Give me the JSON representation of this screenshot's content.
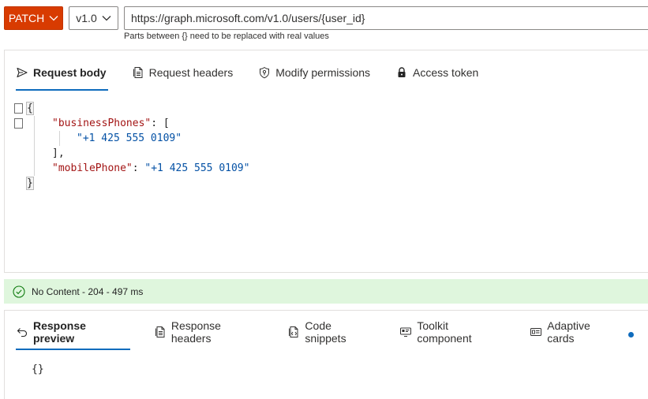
{
  "request": {
    "method": "PATCH",
    "version": "v1.0",
    "url": "https://graph.microsoft.com/v1.0/users/{user_id}",
    "url_hint": "Parts between {} need to be replaced with real values"
  },
  "request_tabs": [
    {
      "label": "Request body",
      "icon": "send-icon",
      "active": true
    },
    {
      "label": "Request headers",
      "icon": "document-icon",
      "active": false
    },
    {
      "label": "Modify permissions",
      "icon": "shield-key-icon",
      "active": false
    },
    {
      "label": "Access token",
      "icon": "lock-icon",
      "active": false
    }
  ],
  "request_body": {
    "open_brace": "{",
    "business_phones_key": "\"businessPhones\"",
    "colon": ": ",
    "open_bracket": "[",
    "phone_value": "\"+1 425 555 0109\"",
    "close_bracket": "],",
    "mobile_phone_key": "\"mobilePhone\"",
    "mobile_phone_value": "\"+1 425 555 0109\"",
    "close_brace": "}"
  },
  "status": {
    "text": "No Content - 204 - 497 ms",
    "color": "#dff6dd",
    "icon": "check-circle-icon"
  },
  "response_tabs": [
    {
      "label": "Response preview",
      "icon": "undo-arrow-icon",
      "active": true
    },
    {
      "label": "Response headers",
      "icon": "document-icon",
      "active": false
    },
    {
      "label": "Code snippets",
      "icon": "code-file-icon",
      "active": false
    },
    {
      "label": "Toolkit component",
      "icon": "toolkit-icon",
      "active": false
    },
    {
      "label": "Adaptive cards",
      "icon": "card-icon",
      "active": false,
      "badge_dot": true
    }
  ],
  "response_body": "{}",
  "colors": {
    "method_button": "#d83b01",
    "accent": "#0f6cbd",
    "json_key": "#a31515",
    "json_string": "#0451a5"
  }
}
